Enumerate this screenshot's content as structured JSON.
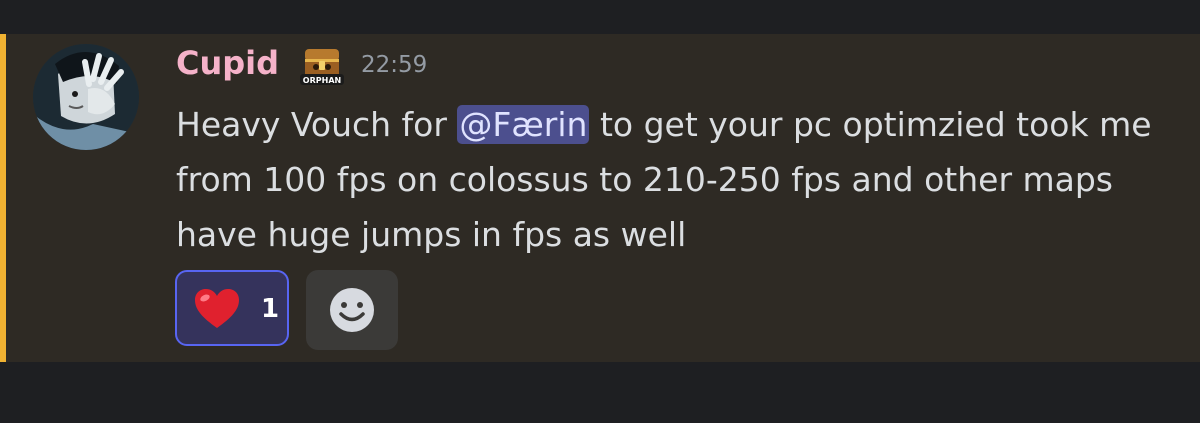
{
  "message": {
    "author": "Cupid",
    "author_color": "#f5b2c9",
    "role_icon_name": "orphan-treasure-chest-icon",
    "role_icon_text": "ORPHAN",
    "timestamp": "22:59",
    "accent_color": "#f0b232",
    "content_before_mention": "Heavy Vouch for ",
    "mention": "@Færin",
    "content_after_mention": " to get your pc optimzied took me from 100 fps on colossus to 210-250 fps and other maps have huge jumps in fps as well"
  },
  "reactions": [
    {
      "emoji_name": "red-heart-icon",
      "count": "1",
      "selected": true
    }
  ],
  "add_reaction_icon": "smile-face-icon"
}
